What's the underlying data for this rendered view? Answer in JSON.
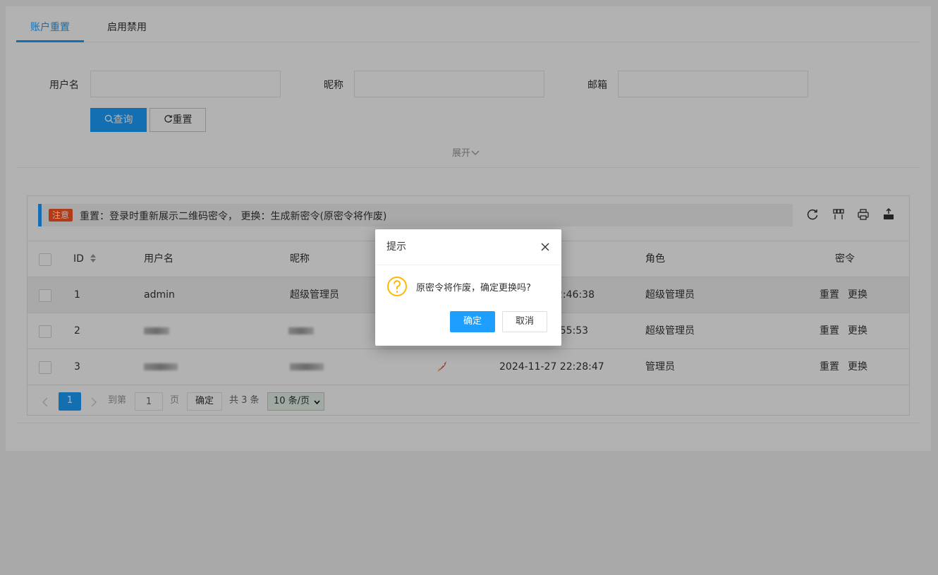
{
  "tabs": [
    {
      "label": "账户重置",
      "active": true
    },
    {
      "label": "启用禁用",
      "active": false
    }
  ],
  "search": {
    "username_label": "用户名",
    "nickname_label": "昵称",
    "email_label": "邮箱",
    "username_value": "",
    "nickname_value": "",
    "email_value": "",
    "query_label": "查询",
    "reset_label": "重置",
    "expand_label": "展开"
  },
  "notice": {
    "badge": "注意",
    "text": "重置：登录时重新展示二维码密令，  更换：生成新密令(原密令将作废)"
  },
  "table": {
    "columns": [
      "ID",
      "用户名",
      "昵称",
      "",
      "",
      "角色",
      "密令"
    ],
    "rows": [
      {
        "id": "1",
        "username": "admin",
        "nickname": "超级管理员",
        "time": "2:46:38",
        "role": "超级管理员",
        "action_reset": "重置",
        "action_change": "更换"
      },
      {
        "id": "2",
        "username": "",
        "nickname": "",
        "time": ":55:53",
        "role": "超级管理员",
        "action_reset": "重置",
        "action_change": "更换"
      },
      {
        "id": "3",
        "username": "",
        "nickname": "",
        "time": "2024-11-27 22:28:47",
        "role": "管理员",
        "action_reset": "重置",
        "action_change": "更换"
      }
    ]
  },
  "pager": {
    "current_page": "1",
    "goto_label": "到第",
    "goto_value": "1",
    "page_unit": "页",
    "confirm_label": "确定",
    "total_label": "共 3 条",
    "page_size": "10 条/页"
  },
  "dialog": {
    "title": "提示",
    "message": "原密令将作废，确定更换吗?",
    "confirm_label": "确定",
    "cancel_label": "取消"
  },
  "colors": {
    "accent": "#1e9fff",
    "notice_badge": "#ff5722",
    "warning_icon": "#ffb800"
  }
}
